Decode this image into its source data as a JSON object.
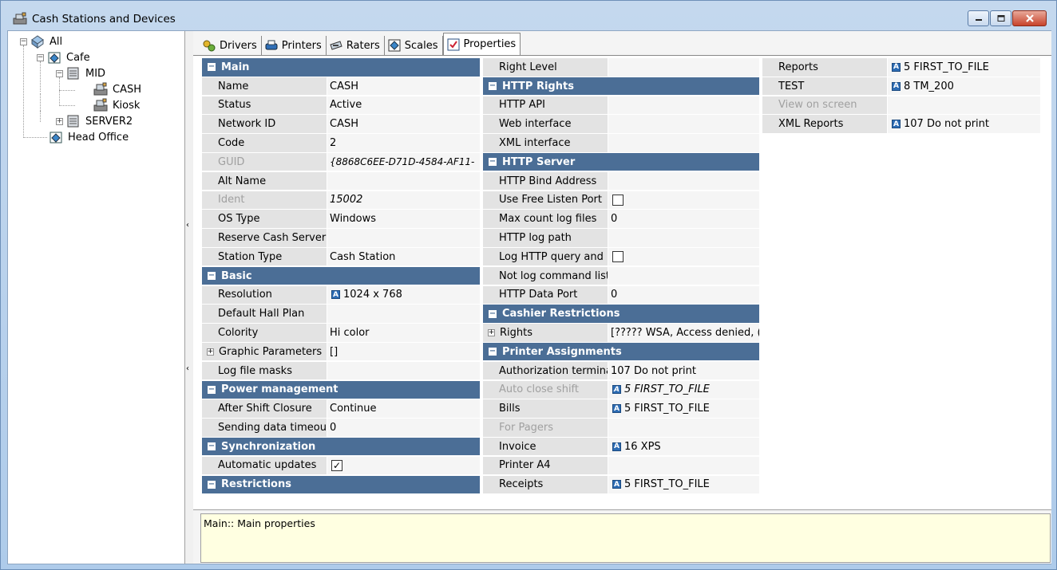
{
  "window": {
    "title": "Cash Stations and Devices",
    "icons": {
      "app": "cash-register-icon",
      "minimize": "minimize-icon",
      "maximize": "maximize-icon",
      "close": "close-icon"
    }
  },
  "tree": {
    "nodes": [
      {
        "label": "All",
        "icon": "globe-network-icon",
        "expander": "−"
      },
      {
        "label": "Cafe",
        "icon": "restaurant-icon",
        "expander": "−"
      },
      {
        "label": "MID",
        "icon": "server-icon",
        "expander": "−"
      },
      {
        "label": "CASH",
        "icon": "cash-register-icon",
        "selected": true
      },
      {
        "label": "Kiosk",
        "icon": "cash-register-icon"
      },
      {
        "label": "SERVER2",
        "icon": "server-icon",
        "expander": "+"
      },
      {
        "label": "Head Office",
        "icon": "office-icon"
      }
    ]
  },
  "tabs": [
    {
      "label": "Drivers",
      "icon": "drivers-icon"
    },
    {
      "label": "Printers",
      "icon": "printer-icon"
    },
    {
      "label": "Raters",
      "icon": "rater-icon"
    },
    {
      "label": "Scales",
      "icon": "scales-icon"
    },
    {
      "label": "Properties",
      "icon": "properties-icon",
      "active": true
    }
  ],
  "col1": {
    "main": {
      "title": "Main",
      "rows": [
        {
          "name": "Name",
          "value": "CASH"
        },
        {
          "name": "Status",
          "value": "Active"
        },
        {
          "name": "Network ID",
          "value": "CASH"
        },
        {
          "name": "Code",
          "value": "2"
        },
        {
          "name": "GUID",
          "value": "{8868C6EE-D71D-4584-AF11-",
          "disabled": true
        },
        {
          "name": "Alt Name",
          "value": ""
        },
        {
          "name": "Ident",
          "value": "15002",
          "disabled": true
        },
        {
          "name": "OS Type",
          "value": "Windows"
        },
        {
          "name": "Reserve Cash Server",
          "value": ""
        },
        {
          "name": "Station Type",
          "value": "Cash Station"
        }
      ]
    },
    "basic": {
      "title": "Basic",
      "rows": [
        {
          "name": "Resolution",
          "value": "1024 x 768"
        },
        {
          "name": "Default Hall Plan",
          "value": ""
        },
        {
          "name": "Colority",
          "value": "Hi color"
        },
        {
          "name": "Graphic Parameters",
          "value": "[]"
        },
        {
          "name": "Log file masks",
          "value": ""
        }
      ]
    },
    "power": {
      "title": "Power management",
      "rows": [
        {
          "name": "After Shift Closure",
          "value": "Continue"
        },
        {
          "name": "Sending data timeout",
          "value": "0"
        }
      ]
    },
    "sync": {
      "title": "Synchronization",
      "rows": [
        {
          "name": "Automatic updates",
          "checked": true
        }
      ]
    },
    "restrictions": {
      "title": "Restrictions"
    }
  },
  "col2": {
    "top": {
      "name": "Right Level",
      "value": ""
    },
    "http_rights": {
      "title": "HTTP Rights",
      "rows": [
        {
          "name": "HTTP API",
          "value": ""
        },
        {
          "name": "Web interface",
          "value": ""
        },
        {
          "name": "XML interface",
          "value": ""
        }
      ]
    },
    "http_server": {
      "title": "HTTP Server",
      "rows": [
        {
          "name": "HTTP Bind Address",
          "value": ""
        },
        {
          "name": "Use Free Listen Port",
          "checked": false
        },
        {
          "name": "Max count log files",
          "value": "0"
        },
        {
          "name": "HTTP log path",
          "value": ""
        },
        {
          "name": "Log HTTP query and r",
          "checked": false
        },
        {
          "name": "Not log command list",
          "value": ""
        },
        {
          "name": "HTTP Data Port",
          "value": "0"
        }
      ]
    },
    "cashier": {
      "title": "Cashier Restrictions",
      "rows": [
        {
          "name": "Rights",
          "value": "[????? WSA, Access denied, ("
        }
      ]
    },
    "printer_assign": {
      "title": "Printer Assignments",
      "rows": [
        {
          "name": "Authorization terminal",
          "value": "107 Do not print"
        },
        {
          "name": "Auto close shift",
          "value": "5 FIRST_TO_FILE",
          "disabled": true
        },
        {
          "name": "Bills",
          "value": "5 FIRST_TO_FILE"
        },
        {
          "name": "For Pagers",
          "value": "",
          "disabled": true
        },
        {
          "name": "Invoice",
          "value": "16 XPS"
        },
        {
          "name": "Printer A4",
          "value": ""
        },
        {
          "name": "Receipts",
          "value": "5 FIRST_TO_FILE"
        }
      ]
    }
  },
  "col3": {
    "rows": [
      {
        "name": "Reports",
        "value": "5 FIRST_TO_FILE"
      },
      {
        "name": "TEST",
        "value": "8 TM_200"
      },
      {
        "name": "View on screen",
        "value": "",
        "disabled": true
      },
      {
        "name": "XML Reports",
        "value": "107 Do not print"
      }
    ]
  },
  "description": {
    "text": "Main:: Main properties"
  }
}
